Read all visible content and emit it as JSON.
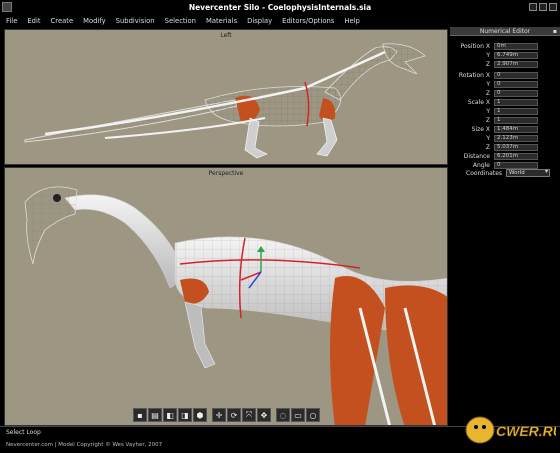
{
  "window": {
    "title": "Nevercenter Silo - CoelophysisInternals.sia"
  },
  "menu": [
    "File",
    "Edit",
    "Create",
    "Modify",
    "Subdivision",
    "Selection",
    "Materials",
    "Display",
    "Editors/Options",
    "Help"
  ],
  "viewports": {
    "top_label": "Left",
    "bottom_label": "Perspective"
  },
  "numerical_editor": {
    "title": "Numerical Editor",
    "groups": [
      {
        "label": "Position",
        "x": "0m",
        "y": "6.749m",
        "z": "2.907m"
      },
      {
        "label": "Rotation",
        "x": "0",
        "y": "0",
        "z": "0"
      },
      {
        "label": "Scale",
        "x": "1",
        "y": "1",
        "z": "1"
      },
      {
        "label": "Size",
        "x": "1.484m",
        "y": "2.123m",
        "z": "5.037m"
      }
    ],
    "distance_label": "Distance",
    "distance": "6.201m",
    "angle_label": "Angle",
    "angle": "0",
    "coordinates_label": "Coordinates",
    "coordinates_value": "World"
  },
  "status": "Select Loop",
  "footer": "Nevercenter.com | Model Copyright © Wes Vayher, 2007",
  "watermark": "CWER.RU",
  "colors": {
    "viewport_bg": "#9c9682",
    "muscle": "#c3501e",
    "model": "#e6e6e6"
  }
}
